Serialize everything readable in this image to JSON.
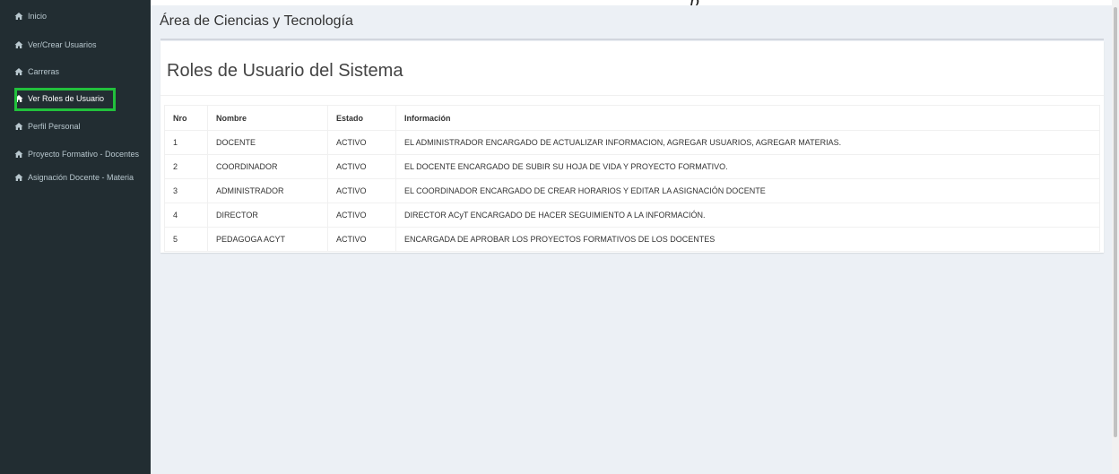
{
  "top_glyph": "p",
  "sidebar": {
    "items": [
      {
        "label": "Inicio",
        "icon": "home-icon"
      },
      {
        "label": "Ver/Crear Usuarios",
        "icon": "home-icon"
      },
      {
        "label": "Carreras",
        "icon": "home-icon"
      },
      {
        "label": "Ver Roles de Usuario",
        "icon": "home-icon",
        "active": true
      },
      {
        "label": "Perfil Personal",
        "icon": "home-icon"
      },
      {
        "label": "Proyecto Formativo - Docentes",
        "icon": "home-icon"
      },
      {
        "label": "Asignación Docente - Materia",
        "icon": "home-icon"
      }
    ]
  },
  "header": {
    "title": "Área de Ciencias y Tecnología"
  },
  "main": {
    "box_title": "Roles de Usuario del Sistema",
    "table": {
      "columns": [
        "Nro",
        "Nombre",
        "Estado",
        "Información"
      ],
      "rows": [
        [
          "1",
          "DOCENTE",
          "ACTIVO",
          "EL ADMINISTRADOR ENCARGADO DE ACTUALIZAR INFORMACION, AGREGAR USUARIOS, AGREGAR MATERIAS."
        ],
        [
          "2",
          "COORDINADOR",
          "ACTIVO",
          "EL DOCENTE ENCARGADO DE SUBIR SU HOJA DE VIDA Y PROYECTO FORMATIVO."
        ],
        [
          "3",
          "ADMINISTRADOR",
          "ACTIVO",
          "EL COORDINADOR ENCARGADO DE CREAR HORARIOS Y EDITAR LA ASIGNACIÓN DOCENTE"
        ],
        [
          "4",
          "DIRECTOR",
          "ACTIVO",
          "DIRECTOR ACyT ENCARGADO DE HACER SEGUIMIENTO A LA INFORMACIÓN."
        ],
        [
          "5",
          "PEDAGOGA ACYT",
          "ACTIVO",
          "ENCARGADA DE APROBAR LOS PROYECTOS FORMATIVOS DE LOS DOCENTES"
        ]
      ]
    }
  },
  "colors": {
    "sidebar_bg": "#222d32",
    "sidebar_text": "#b8c7ce",
    "active_highlight": "#22c03c",
    "content_bg": "#ecf0f5"
  }
}
